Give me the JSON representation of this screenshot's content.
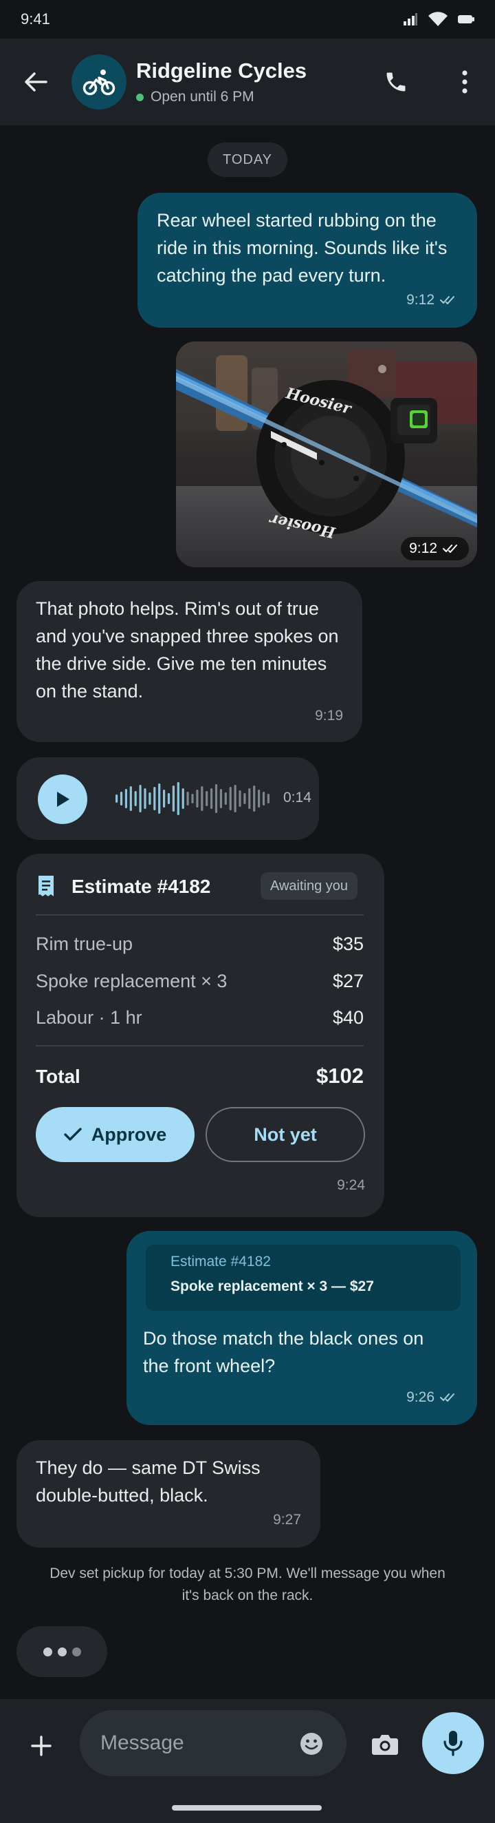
{
  "status_bar": {
    "time": "9:41"
  },
  "header": {
    "contact_name": "Ridgeline Cycles",
    "presence": "Open until 6 PM",
    "avatar_icon": "bicycle-icon"
  },
  "date_chip": "TODAY",
  "messages": [
    {
      "direction": "outgoing",
      "text": "Rear wheel started rubbing on the ride in this morning. Sounds like it's catching the pad every turn.",
      "time": "9:12",
      "status": "read"
    },
    {
      "direction": "outgoing",
      "type": "photo",
      "time": "9:12",
      "status": "read",
      "photo_text": {
        "brand_top": "Hoosier",
        "brand_bottom": "Hoosier"
      }
    },
    {
      "direction": "incoming",
      "text": "That photo helps. Rim's out of true and you've snapped three spokes on the drive side. Give me ten minutes on the stand.",
      "time": "9:19"
    },
    {
      "direction": "incoming",
      "type": "voice",
      "duration": "0:14"
    },
    {
      "direction": "incoming",
      "type": "estimate",
      "title": "Estimate #4182",
      "status": "Awaiting you",
      "line_items": [
        {
          "label": "Rim true-up",
          "amount": "$35"
        },
        {
          "label": "Spoke replacement × 3",
          "amount": "$27"
        },
        {
          "label": "Labour · 1 hr",
          "amount": "$40"
        }
      ],
      "total_label": "Total",
      "total_amount": "$102",
      "approve_label": "Approve",
      "decline_label": "Not yet",
      "time": "9:24"
    },
    {
      "direction": "outgoing",
      "type": "reply",
      "quote_title": "Estimate #4182",
      "quote_text": "Spoke replacement × 3 — $27",
      "text": "Do those match the black ones on the front wheel?",
      "time": "9:26",
      "status": "read"
    },
    {
      "direction": "incoming",
      "text": "They do — same DT Swiss double-butted, black.",
      "time": "9:27"
    }
  ],
  "system_note": "Dev set pickup for today at 5:30 PM. We'll message you when it's back on the rack.",
  "composer": {
    "placeholder": "Message"
  },
  "colors": {
    "background": "#121417",
    "header": "#1e2226",
    "outgoing_bubble": "#0b4a5e",
    "incoming_bubble": "#24282c",
    "accent": "#a6dcf5",
    "presence_dot": "#4fc07a"
  }
}
